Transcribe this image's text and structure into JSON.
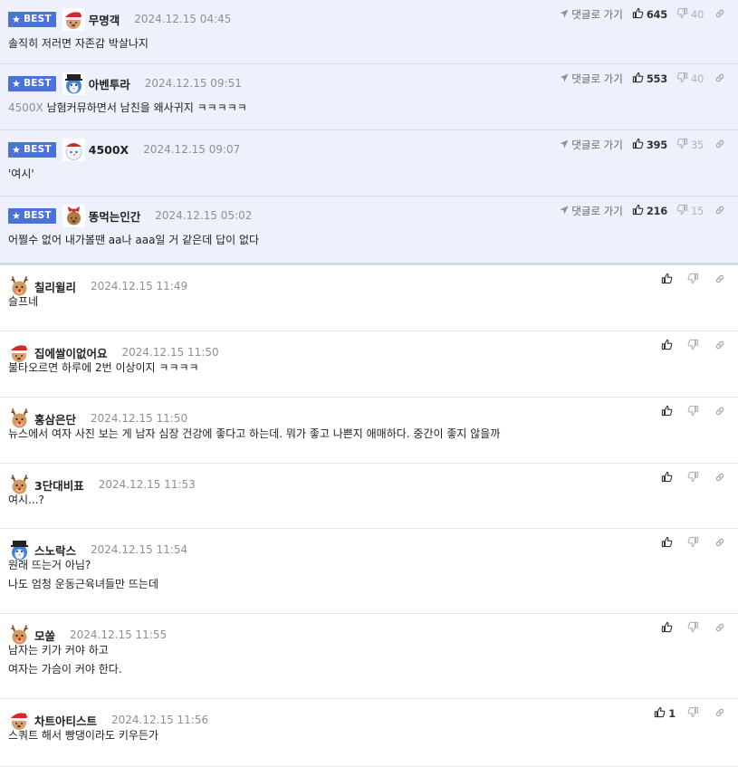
{
  "colors": {
    "best_bg": "#eef1fb",
    "badge": "#4a72d9",
    "muted": "#8a8f99"
  },
  "labels": {
    "best": "BEST",
    "reply": "댓글로 가기"
  },
  "best_comments": [
    {
      "avatar": "santa-hat",
      "nick": "무명객",
      "time": "2024.12.15 04:45",
      "text": "솔직히 저러면 자존감 박살나지",
      "up": "645",
      "down": "40"
    },
    {
      "avatar": "penguin-hat",
      "nick": "아벤투라",
      "time": "2024.12.15 09:51",
      "text_dim": "4500X ",
      "text": "남혐커뮤하면서 남친을 왜사귀지 ㅋㅋㅋㅋㅋ",
      "up": "553",
      "down": "40"
    },
    {
      "avatar": "snowman",
      "nick": "4500X",
      "time": "2024.12.15 09:07",
      "text": "'여시'",
      "up": "395",
      "down": "35"
    },
    {
      "avatar": "gift",
      "nick": "똥먹는인간",
      "time": "2024.12.15 05:02",
      "text": "어쩔수 없어 내가볼땐 aa나 aaa일 거 같은데 답이 없다",
      "up": "216",
      "down": "15"
    }
  ],
  "comments": [
    {
      "avatar": "reindeer",
      "nick": "칠리윌리",
      "time": "2024.12.15 11:49",
      "lines": [
        "슬프네"
      ],
      "up": ""
    },
    {
      "avatar": "santa-hat",
      "nick": "집에쌀이없어요",
      "time": "2024.12.15 11:50",
      "lines": [
        "불타오르면 하루에 2번 이상이지 ㅋㅋㅋㅋ"
      ],
      "up": ""
    },
    {
      "avatar": "reindeer",
      "nick": "홍삼은단",
      "time": "2024.12.15 11:50",
      "lines": [
        "뉴스에서 여자 사진 보는 게 남자 심장 건강에 좋다고 하는데. 뭐가 좋고 나쁜지 애매하다. 중간이 좋지 않을까"
      ],
      "up": ""
    },
    {
      "avatar": "reindeer",
      "nick": "3단대비표",
      "time": "2024.12.15 11:53",
      "lines": [
        "여시...?"
      ],
      "up": ""
    },
    {
      "avatar": "penguin-hat",
      "nick": "스노락스",
      "time": "2024.12.15 11:54",
      "lines": [
        "원래 뜨는거 아님?",
        "나도 엄청 운동근육녀들만 뜨는데"
      ],
      "up": ""
    },
    {
      "avatar": "reindeer",
      "nick": "모쏠",
      "time": "2024.12.15 11:55",
      "lines": [
        "남자는 키가 커야 하고",
        "여자는 가슴이 커야 한다."
      ],
      "up": ""
    },
    {
      "avatar": "santa-hat",
      "nick": "차트아티스트",
      "time": "2024.12.15 11:56",
      "lines": [
        "스쿼트 해서 빵댕이라도 키우든가"
      ],
      "up": "1"
    }
  ]
}
